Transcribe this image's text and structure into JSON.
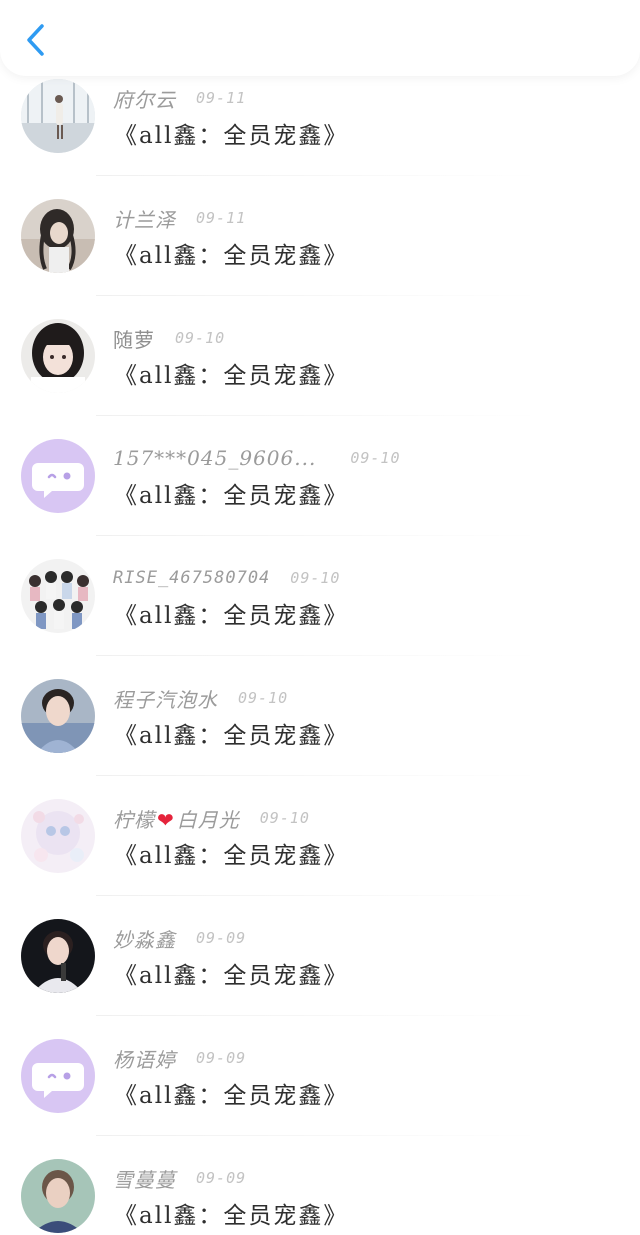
{
  "header": {
    "back_icon": "chevron-left-icon",
    "accent": "#2f9bf2"
  },
  "items": [
    {
      "name": "府尔云",
      "date": "09-11",
      "title": "《all鑫：全员宠鑫》",
      "avatar": "photo"
    },
    {
      "name": "计兰泽",
      "date": "09-11",
      "title": "《all鑫：全员宠鑫》",
      "avatar": "photo"
    },
    {
      "name": "随萝",
      "date": "09-10",
      "title": "《all鑫：全员宠鑫》",
      "avatar": "photo"
    },
    {
      "name": "157***045_9606...",
      "date": "09-10",
      "title": "《all鑫：全员宠鑫》",
      "avatar": "default-chat"
    },
    {
      "name": "RISE_467580704",
      "date": "09-10",
      "title": "《all鑫：全员宠鑫》",
      "avatar": "photo"
    },
    {
      "name": "程子汽泡水",
      "date": "09-10",
      "title": "《all鑫：全员宠鑫》",
      "avatar": "photo"
    },
    {
      "name": "柠檬",
      "name_suffix": "白月光",
      "date": "09-10",
      "title": "《all鑫：全员宠鑫》",
      "avatar": "photo"
    },
    {
      "name": "妙淼鑫",
      "date": "09-09",
      "title": "《all鑫：全员宠鑫》",
      "avatar": "photo"
    },
    {
      "name": "杨语婷",
      "date": "09-09",
      "title": "《all鑫：全员宠鑫》",
      "avatar": "default-chat"
    },
    {
      "name": "雪蔓蔓",
      "date": "09-09",
      "title": "《all鑫：全员宠鑫》",
      "avatar": "photo"
    }
  ]
}
